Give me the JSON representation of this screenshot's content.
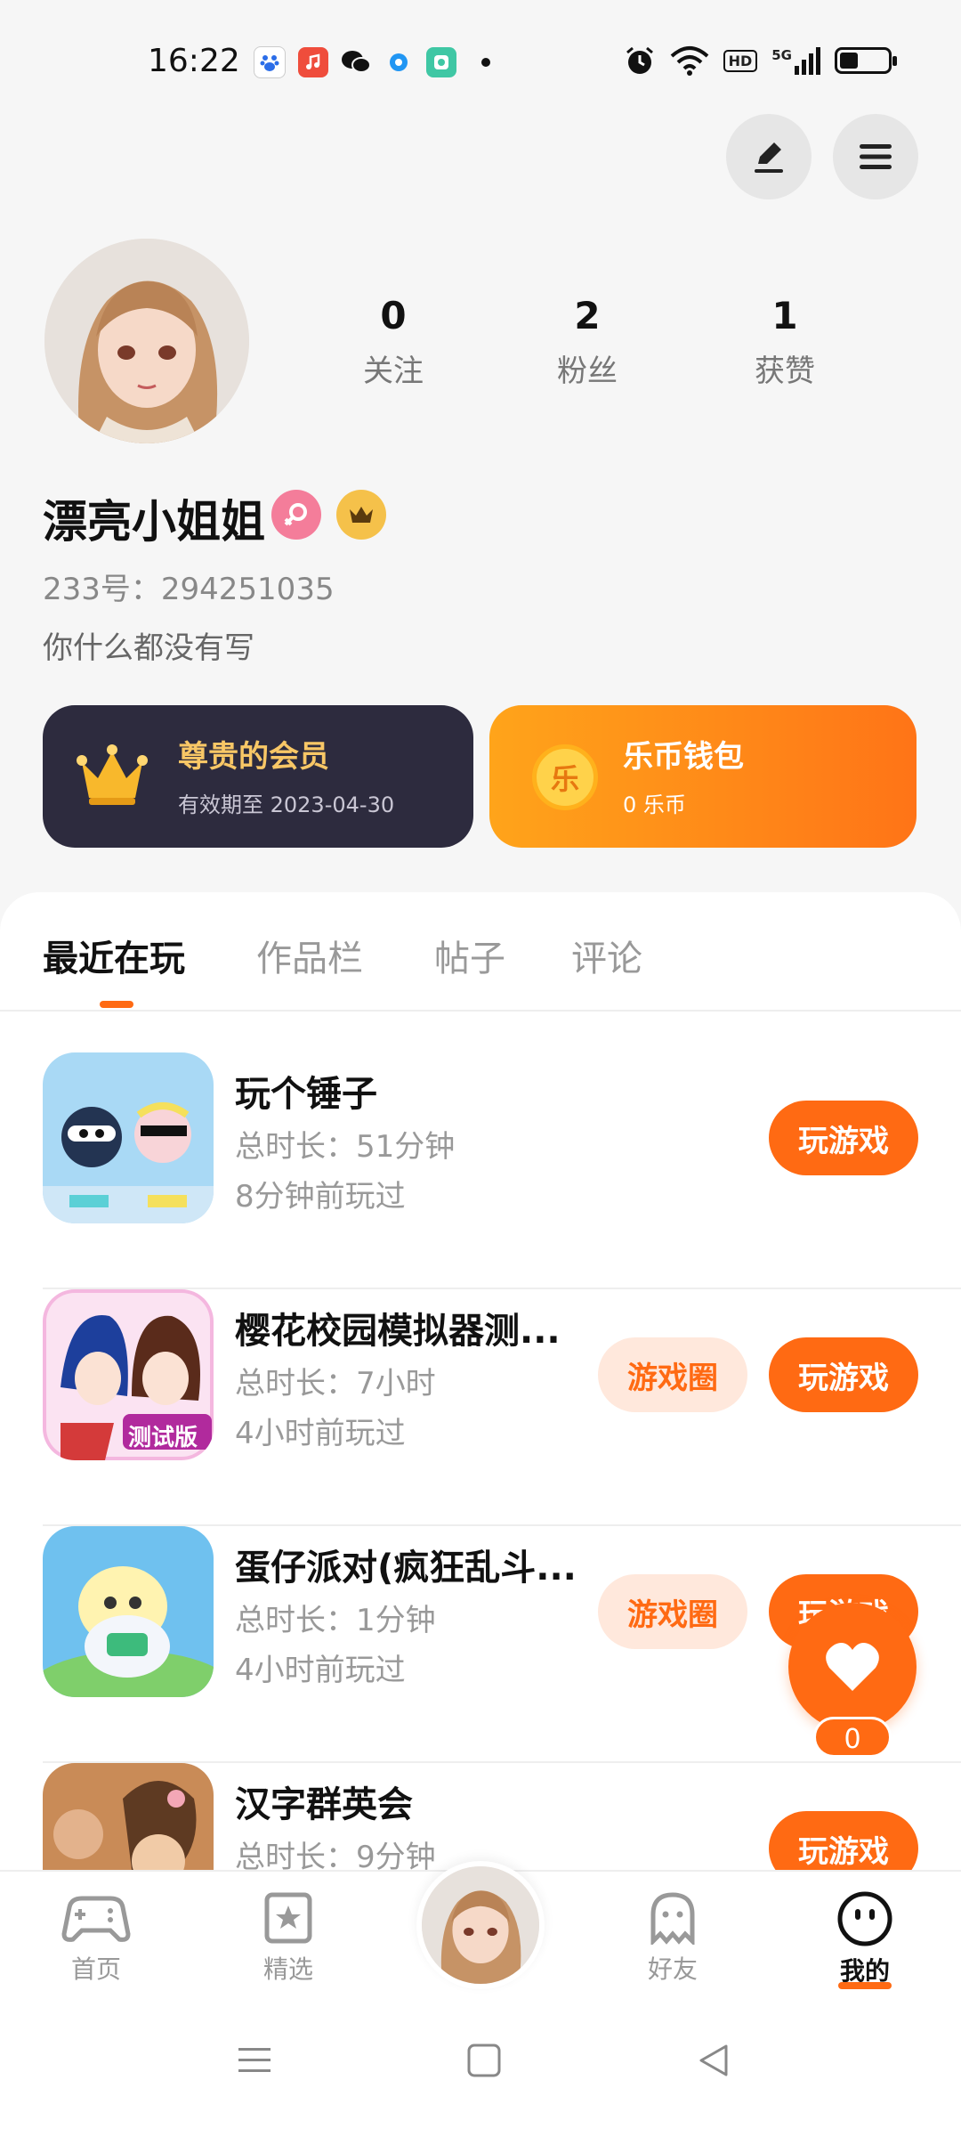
{
  "status_bar": {
    "time": "16:22",
    "notification_icons": [
      "baidu-icon",
      "music-icon",
      "wechat-icon",
      "dot-app-icon",
      "camera-app-icon"
    ],
    "system_icons": [
      "alarm-icon",
      "wifi-icon",
      "hd-icon",
      "5g-signal-icon",
      "battery-icon"
    ],
    "hd_label": "HD",
    "network_label": "5G"
  },
  "header": {
    "edit_icon": "edit-icon",
    "menu_icon": "menu-icon"
  },
  "profile": {
    "stats": [
      {
        "value": "0",
        "label": "关注"
      },
      {
        "value": "2",
        "label": "粉丝"
      },
      {
        "value": "1",
        "label": "获赞"
      }
    ],
    "nickname": "漂亮小姐姐",
    "user_id": "233号：294251035",
    "bio": "你什么都没有写"
  },
  "cards": {
    "member": {
      "title": "尊贵的会员",
      "subtitle": "有效期至 2023-04-30"
    },
    "wallet": {
      "title": "乐币钱包",
      "subtitle": "0 乐币",
      "coin_label": "乐"
    }
  },
  "tabs": [
    {
      "label": "最近在玩",
      "active": true
    },
    {
      "label": "作品栏",
      "active": false
    },
    {
      "label": "帖子",
      "active": false
    },
    {
      "label": "评论",
      "active": false
    }
  ],
  "games": [
    {
      "name": "玩个锤子",
      "duration": "总时长：51分钟",
      "last_played": "8分钟前玩过",
      "circle_label": "",
      "play_label": "玩游戏"
    },
    {
      "name": "樱花校园模拟器测...",
      "duration": "总时长：7小时",
      "last_played": "4小时前玩过",
      "circle_label": "游戏圈",
      "play_label": "玩游戏",
      "icon_text": "测试版"
    },
    {
      "name": "蛋仔派对(疯狂乱斗...",
      "duration": "总时长：1分钟",
      "last_played": "4小时前玩过",
      "circle_label": "游戏圈",
      "play_label": "玩游戏"
    },
    {
      "name": "汉字群英会",
      "duration": "总时长：9分钟",
      "last_played": "",
      "circle_label": "",
      "play_label": "玩游戏"
    }
  ],
  "floating": {
    "like_count": "0"
  },
  "bottom_nav": [
    {
      "label": "首页",
      "icon": "gamepad-icon",
      "active": false
    },
    {
      "label": "精选",
      "icon": "star-bookmark-icon",
      "active": false
    },
    {
      "label": "",
      "icon": "avatar-center-icon",
      "active": false
    },
    {
      "label": "好友",
      "icon": "ghost-icon",
      "active": false
    },
    {
      "label": "我的",
      "icon": "smile-face-icon",
      "active": true
    }
  ],
  "colors": {
    "accent": "#ff6a13",
    "member_card": "#2d2b3e",
    "gold": "#f5c14a",
    "pink": "#f47d9a"
  }
}
